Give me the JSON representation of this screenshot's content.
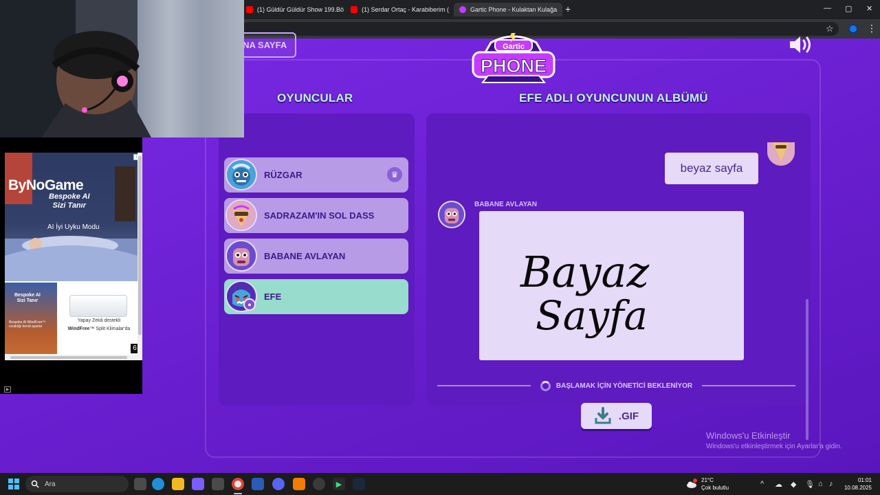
{
  "browser": {
    "tabs": [
      {
        "label": "(1) Güldür Güldür Show 199.Bö",
        "favicon_color": "#ff0000"
      },
      {
        "label": "(1) Serdar Ortaç - Karabiberim (",
        "favicon_color": "#ff0000"
      },
      {
        "label": "Gartic Phone - Kulaktan Kulağa",
        "favicon_color": "#c43cff"
      }
    ],
    "new_tab": "+",
    "window_controls": {
      "minimize": "—",
      "maximize": "▢",
      "close": "✕"
    }
  },
  "game": {
    "home_button": "ANA SAYFA",
    "logo_top": "Gartic",
    "logo_bottom": "PHONE",
    "players_heading": "OYUNCULAR",
    "album_heading": "EFE ADLI OYUNCUNUN ALBÜMÜ",
    "players": [
      {
        "name": "RÜZGAR",
        "host": true,
        "active": false
      },
      {
        "name": "SADRAZAM'IN SOL DASS",
        "host": false,
        "active": false
      },
      {
        "name": "BABANE AVLAYAN",
        "host": false,
        "active": false
      },
      {
        "name": "EFE",
        "host": false,
        "active": true
      }
    ],
    "album": {
      "previous_text": "beyaz sayfa",
      "author": "BABANE AVLAYAN",
      "drawing_words": [
        "Bayaz",
        "Sayfa"
      ]
    },
    "waiting_text": "BAŞLAMAK İÇİN YÖNETİCİ BEKLENİYOR",
    "gif_button": ".GIF",
    "colors": {
      "accent_teal": "#97dccc",
      "panel": "#5e1bbf",
      "background": "#6a1fd0"
    }
  },
  "activation": {
    "title": "Windows'u Etkinleştir",
    "subtitle": "Windows'u etkinleştirmek için Ayarlar'a gidin."
  },
  "ad": {
    "brand": "ByNoGame",
    "tagline": "Bespoke AI\nSizi Tanır",
    "mode": "AI İyi Uyku Modu",
    "left_tag": "Bespoke AI\nSizi Tanır",
    "left_small": "Bespoke AI WindFree™ sıcaklığı kendi ayarlar",
    "copy_line1": "Yapay Zekâ destekli",
    "copy_brand": "WindFree",
    "copy_line2": "™ Split Klimalar'da",
    "corner_number": "6"
  },
  "taskbar": {
    "search_placeholder": "Ara",
    "weather_temp": "21°C",
    "weather_desc": "Çok bulutlu",
    "time": "01:01",
    "date": "10.08.2025"
  }
}
